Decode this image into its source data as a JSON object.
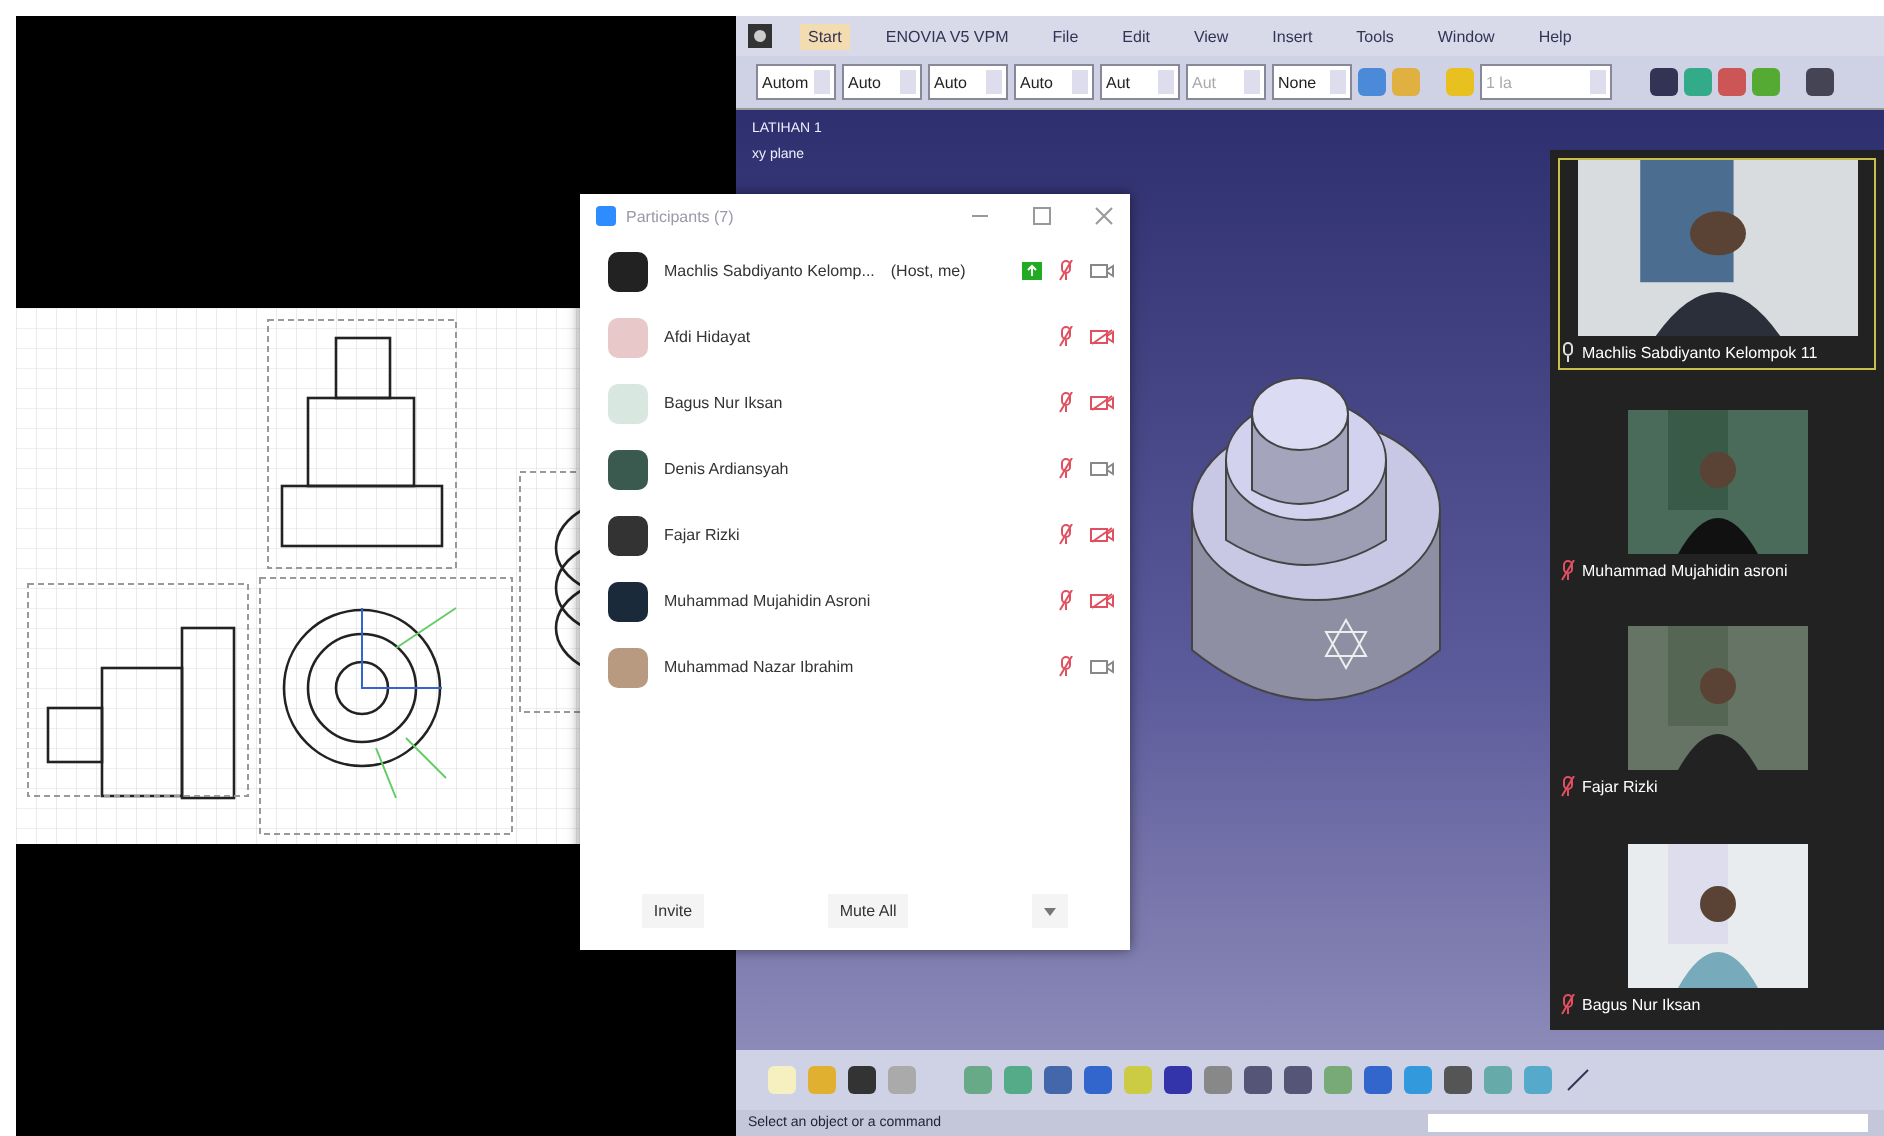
{
  "catia": {
    "menu": [
      {
        "label": "Start",
        "selected": true
      },
      {
        "label": "ENOVIA V5 VPM",
        "selected": false
      },
      {
        "label": "File",
        "selected": false
      },
      {
        "label": "Edit",
        "selected": false
      },
      {
        "label": "View",
        "selected": false
      },
      {
        "label": "Insert",
        "selected": false
      },
      {
        "label": "Tools",
        "selected": false
      },
      {
        "label": "Window",
        "selected": false
      },
      {
        "label": "Help",
        "selected": false
      }
    ],
    "dropdowns": [
      {
        "value": "Autom",
        "disabled": false
      },
      {
        "value": "Auto",
        "disabled": false
      },
      {
        "value": "Auto",
        "disabled": false
      },
      {
        "value": "Auto",
        "disabled": false
      },
      {
        "value": "Aut",
        "disabled": false
      },
      {
        "value": "Aut",
        "disabled": true
      },
      {
        "value": "None",
        "disabled": false
      }
    ],
    "layer_field": "1 la",
    "tree": [
      "LATIHAN 1",
      "xy plane"
    ],
    "status": "Select an object or a command"
  },
  "participants": {
    "title": "Participants (7)",
    "rows": [
      {
        "name": "Machlis Sabdiyanto Kelomp...",
        "role": "(Host, me)",
        "sharing": true,
        "muted": true,
        "video_off": false
      },
      {
        "name": "Afdi Hidayat",
        "sharing": false,
        "muted": true,
        "video_off": true
      },
      {
        "name": "Bagus Nur Iksan",
        "sharing": false,
        "muted": true,
        "video_off": true
      },
      {
        "name": "Denis Ardiansyah",
        "sharing": false,
        "muted": true,
        "video_off": false
      },
      {
        "name": "Fajar Rizki",
        "sharing": false,
        "muted": true,
        "video_off": true
      },
      {
        "name": "Muhammad Mujahidin Asroni",
        "sharing": false,
        "muted": true,
        "video_off": true
      },
      {
        "name": "Muhammad Nazar Ibrahim",
        "sharing": false,
        "muted": true,
        "video_off": false
      }
    ],
    "buttons": [
      "Invite",
      "Mute All"
    ]
  },
  "videos": [
    {
      "name": "Machlis Sabdiyanto Kelompok 11",
      "muted": false,
      "active": true
    },
    {
      "name": "Muhammad Mujahidin asroni",
      "muted": true,
      "active": false
    },
    {
      "name": "Fajar Rizki",
      "muted": true,
      "active": false
    },
    {
      "name": "Bagus Nur Iksan",
      "muted": true,
      "active": false
    }
  ]
}
